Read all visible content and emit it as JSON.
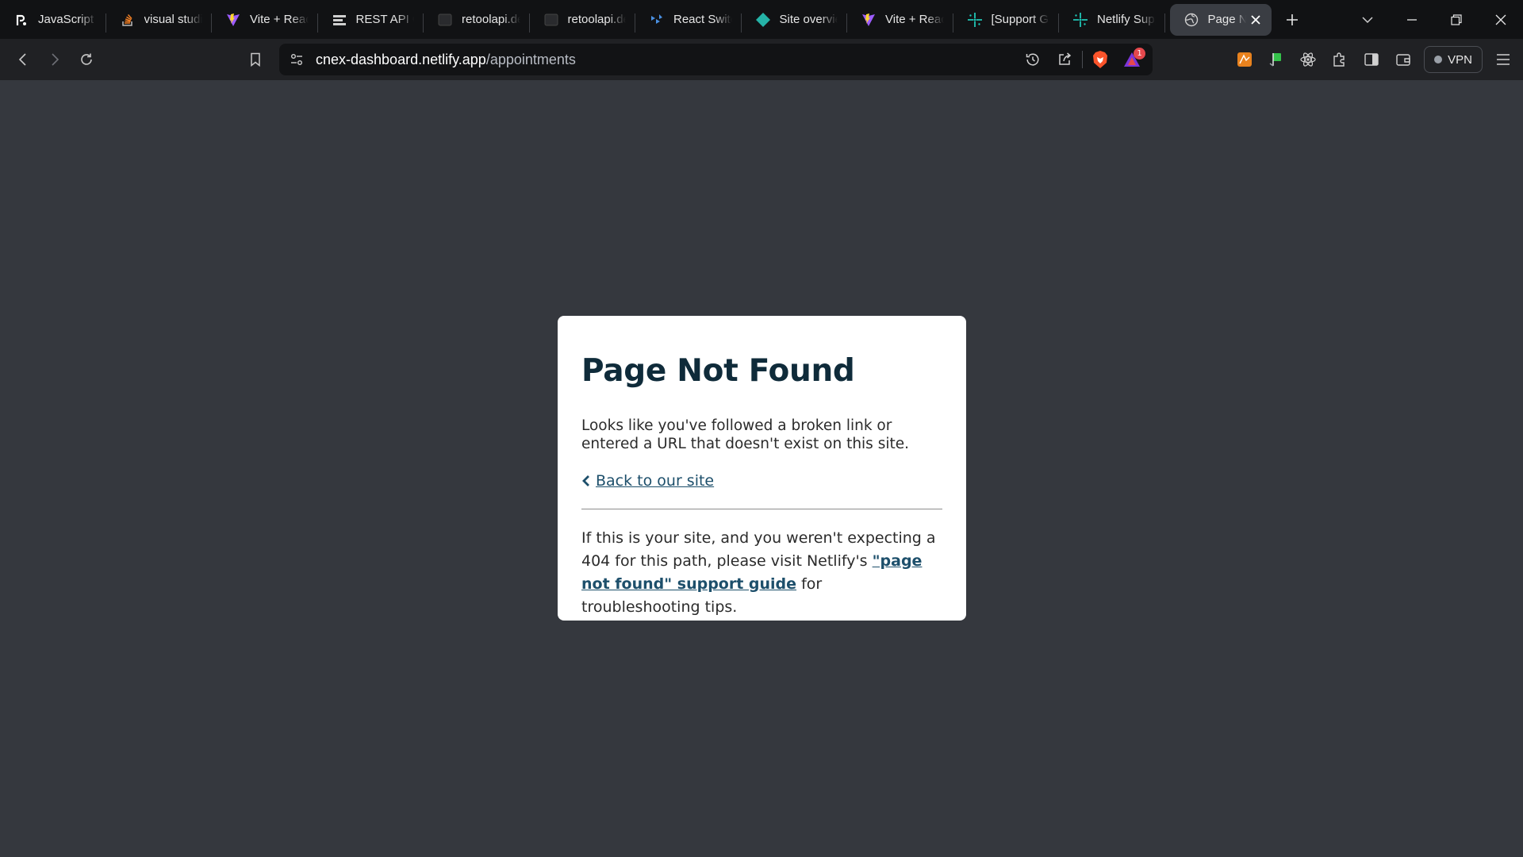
{
  "browser": {
    "tabs": [
      {
        "title": "JavaScript C",
        "icon": "r-logo-icon"
      },
      {
        "title": "visual studio",
        "icon": "stackoverflow-icon"
      },
      {
        "title": "Vite + React",
        "icon": "vite-icon"
      },
      {
        "title": "REST API Gu",
        "icon": "api-doc-icon"
      },
      {
        "title": "retoolapi.dev",
        "icon": "retool-icon"
      },
      {
        "title": "retoolapi.dev",
        "icon": "retool-icon"
      },
      {
        "title": "React Switch",
        "icon": "react-switch-icon"
      },
      {
        "title": "Site overview",
        "icon": "netlify-diamond-icon"
      },
      {
        "title": "Vite + React",
        "icon": "vite-icon"
      },
      {
        "title": "[Support Gu",
        "icon": "netlify-support-icon"
      },
      {
        "title": "Netlify Supp",
        "icon": "netlify-support-icon"
      },
      {
        "title": "Page N",
        "icon": "globe-icon",
        "active": true
      }
    ],
    "url": {
      "host": "cnex-dashboard.netlify.app",
      "path": "/appointments"
    },
    "vpn_label": "VPN",
    "notification_count": "1",
    "colors": {
      "tab_strip": "#111214",
      "toolbar": "#202124",
      "page_bg": "#35383e",
      "link": "#1d4f6b",
      "brave_orange": "#fb542b"
    }
  },
  "page": {
    "title": "Page Not Found",
    "lead": "Looks like you've followed a broken link or entered a URL that doesn't exist on this site.",
    "back_link": "Back to our site",
    "tail_before": "If this is your site, and you weren't expecting a 404 for this path, please visit Netlify's ",
    "guide_link": "\"page not found\" support guide",
    "tail_after": " for troubleshooting tips."
  }
}
